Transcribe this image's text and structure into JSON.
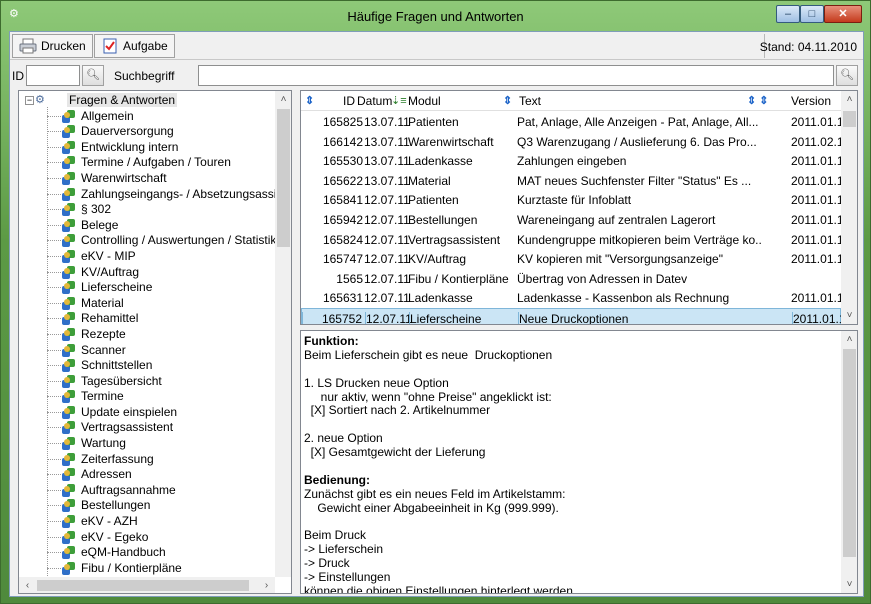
{
  "window": {
    "title": "Häufige Fragen und Antworten",
    "buttons": {
      "minimize": "–",
      "maximize": "□",
      "close": "✕"
    }
  },
  "toolbar": {
    "print_label": "Drucken",
    "task_label": "Aufgabe",
    "stand": "Stand: 04.11.2010"
  },
  "search": {
    "id_label": "ID",
    "id_value": "",
    "term_label": "Suchbegriff",
    "term_value": ""
  },
  "tree": {
    "root": "Fragen & Antworten",
    "items": [
      "Allgemein",
      "Dauerversorgung",
      "Entwicklung intern",
      "Termine / Aufgaben / Touren",
      "Warenwirtschaft",
      "Zahlungseingangs- / Absetzungsassis",
      "§ 302",
      "Belege",
      "Controlling / Auswertungen / Statistik",
      "eKV - MIP",
      "KV/Auftrag",
      "Lieferscheine",
      "Material",
      "Rehamittel",
      "Rezepte",
      "Scanner",
      "Schnittstellen",
      "Tagesübersicht",
      "Termine",
      "Update einspielen",
      "Vertragsassistent",
      "Wartung",
      "Zeiterfassung",
      "Adressen",
      "Auftragsannahme",
      "Bestellungen",
      "eKV - AZH",
      "eKV - Egeko",
      "eQM-Handbuch",
      "Fibu / Kontierpläne"
    ],
    "selected": "Fragen & Antworten",
    "scroll_fraction": 0.0
  },
  "grid": {
    "columns": {
      "id": "ID",
      "datum": "Datum",
      "modul": "Modul",
      "text": "Text",
      "version": "Version"
    },
    "rows": [
      {
        "id": "165825",
        "datum": "13.07.11",
        "modul": "Patienten",
        "text": "Pat, Anlage, Alle Anzeigen - Pat, Anlage, All...",
        "version": "2011.01.1"
      },
      {
        "id": "166142",
        "datum": "13.07.11",
        "modul": "Warenwirtschaft",
        "text": "Q3 Warenzugang / Auslieferung  6. Das Pro...",
        "version": "2011.02.1"
      },
      {
        "id": "165530",
        "datum": "13.07.11",
        "modul": "Ladenkasse",
        "text": "Zahlungen eingeben",
        "version": "2011.01.1"
      },
      {
        "id": "165622",
        "datum": "13.07.11",
        "modul": "Material",
        "text": "MAT neues Suchfenster  Filter \"Status\" Es ...",
        "version": "2011.01.1"
      },
      {
        "id": "165841",
        "datum": "12.07.11",
        "modul": "Patienten",
        "text": "Kurztaste für Infoblatt",
        "version": "2011.01.1"
      },
      {
        "id": "165942",
        "datum": "12.07.11",
        "modul": "Bestellungen",
        "text": "Wareneingang   auf zentralen Lagerort",
        "version": "2011.01.1"
      },
      {
        "id": "165824",
        "datum": "12.07.11",
        "modul": "Vertragsassistent",
        "text": "Kundengruppe mitkopieren beim Verträge ko...",
        "version": "2011.01.1"
      },
      {
        "id": "165747",
        "datum": "12.07.11",
        "modul": "KV/Auftrag",
        "text": "KV kopieren   mit  \"Versorgungsanzeige\"",
        "version": "2011.01.1"
      },
      {
        "id": "1565",
        "datum": "12.07.11",
        "modul": "Fibu / Kontierpläne",
        "text": "Übertrag von Adressen in Datev",
        "version": ""
      },
      {
        "id": "165631",
        "datum": "12.07.11",
        "modul": "Ladenkasse",
        "text": "Ladenkasse - Kassenbon als Rechnung",
        "version": "2011.01.1"
      },
      {
        "id": "165752",
        "datum": "12.07.11",
        "modul": "Lieferscheine",
        "text": "Neue Druckoptionen",
        "version": "2011.01.1"
      }
    ],
    "selected_id": "165752"
  },
  "detail": {
    "lines": [
      {
        "text": "Funktion:",
        "bold": true
      },
      {
        "text": "Beim Lieferschein gibt es neue  Druckoptionen",
        "bold": false
      },
      {
        "text": "",
        "bold": false
      },
      {
        "text": "1. LS Drucken neue Option",
        "bold": false
      },
      {
        "text": "     nur aktiv, wenn \"ohne Preise\" angeklickt ist:",
        "bold": false
      },
      {
        "text": "  [X] Sortiert nach 2. Artikelnummer",
        "bold": false
      },
      {
        "text": "",
        "bold": false
      },
      {
        "text": "2. neue Option",
        "bold": false
      },
      {
        "text": "  [X] Gesamtgewicht der Lieferung",
        "bold": false
      },
      {
        "text": "",
        "bold": false
      },
      {
        "text": "Bedienung:",
        "bold": true
      },
      {
        "text": "Zunächst gibt es ein neues Feld im Artikelstamm:",
        "bold": false
      },
      {
        "text": "    Gewicht einer Abgabeeinheit in Kg (999.999).",
        "bold": false
      },
      {
        "text": "",
        "bold": false
      },
      {
        "text": "Beim Druck",
        "bold": false
      },
      {
        "text": "-> Lieferschein",
        "bold": false
      },
      {
        "text": "-> Druck",
        "bold": false
      },
      {
        "text": "-> Einstellungen",
        "bold": false
      },
      {
        "text": "können die obigen Einstellungen hinterlegt werden.",
        "bold": false
      }
    ]
  },
  "colors": {
    "selection": "#cbe5f5",
    "window_frame": "#5c9a45",
    "sort_icon": "#1a62c8"
  }
}
